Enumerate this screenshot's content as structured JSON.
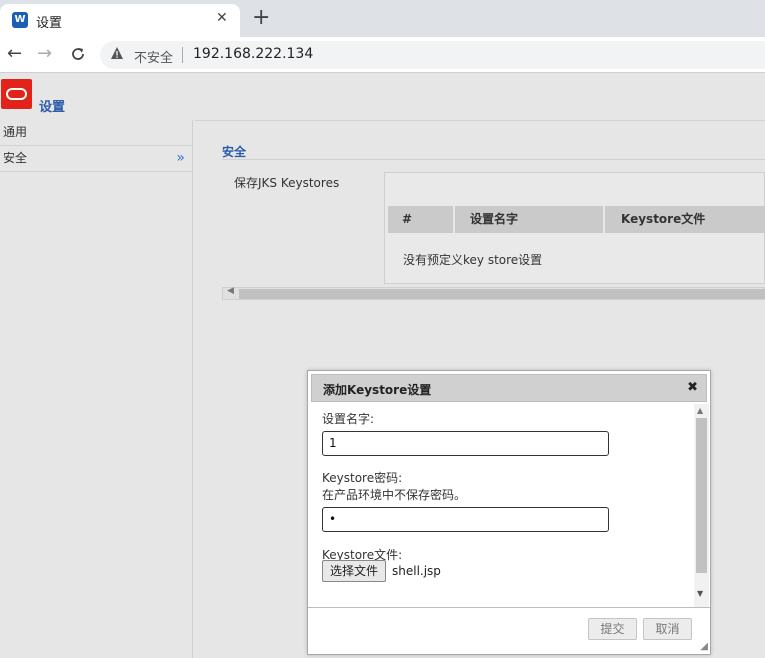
{
  "browser": {
    "tab_title": "设置",
    "tab_favicon": "W",
    "tab_close": "✕",
    "new_tab": "+",
    "back": "←",
    "forward": "→",
    "reload": "C",
    "security_warning": "不安全",
    "url": "192.168.222.134"
  },
  "header": {
    "title": "设置"
  },
  "sidebar": {
    "items": [
      {
        "label": "通用"
      },
      {
        "label": "安全",
        "chevron": "»"
      }
    ]
  },
  "main": {
    "section_title": "安全",
    "field_label": "保存JKS Keystores",
    "table": {
      "columns": [
        "#",
        "设置名字",
        "Keystore文件"
      ],
      "empty_message": "没有预定义key store设置"
    }
  },
  "modal": {
    "title": "添加Keystore设置",
    "close": "✖",
    "name_label": "设置名字:",
    "name_value": "1",
    "password_label": "Keystore密码:",
    "password_hint": "在产品环境中不保存密码。",
    "password_value": "•",
    "file_label": "Keystore文件:",
    "file_button": "选择文件",
    "file_name": "shell.jsp",
    "submit": "提交",
    "cancel": "取消"
  }
}
